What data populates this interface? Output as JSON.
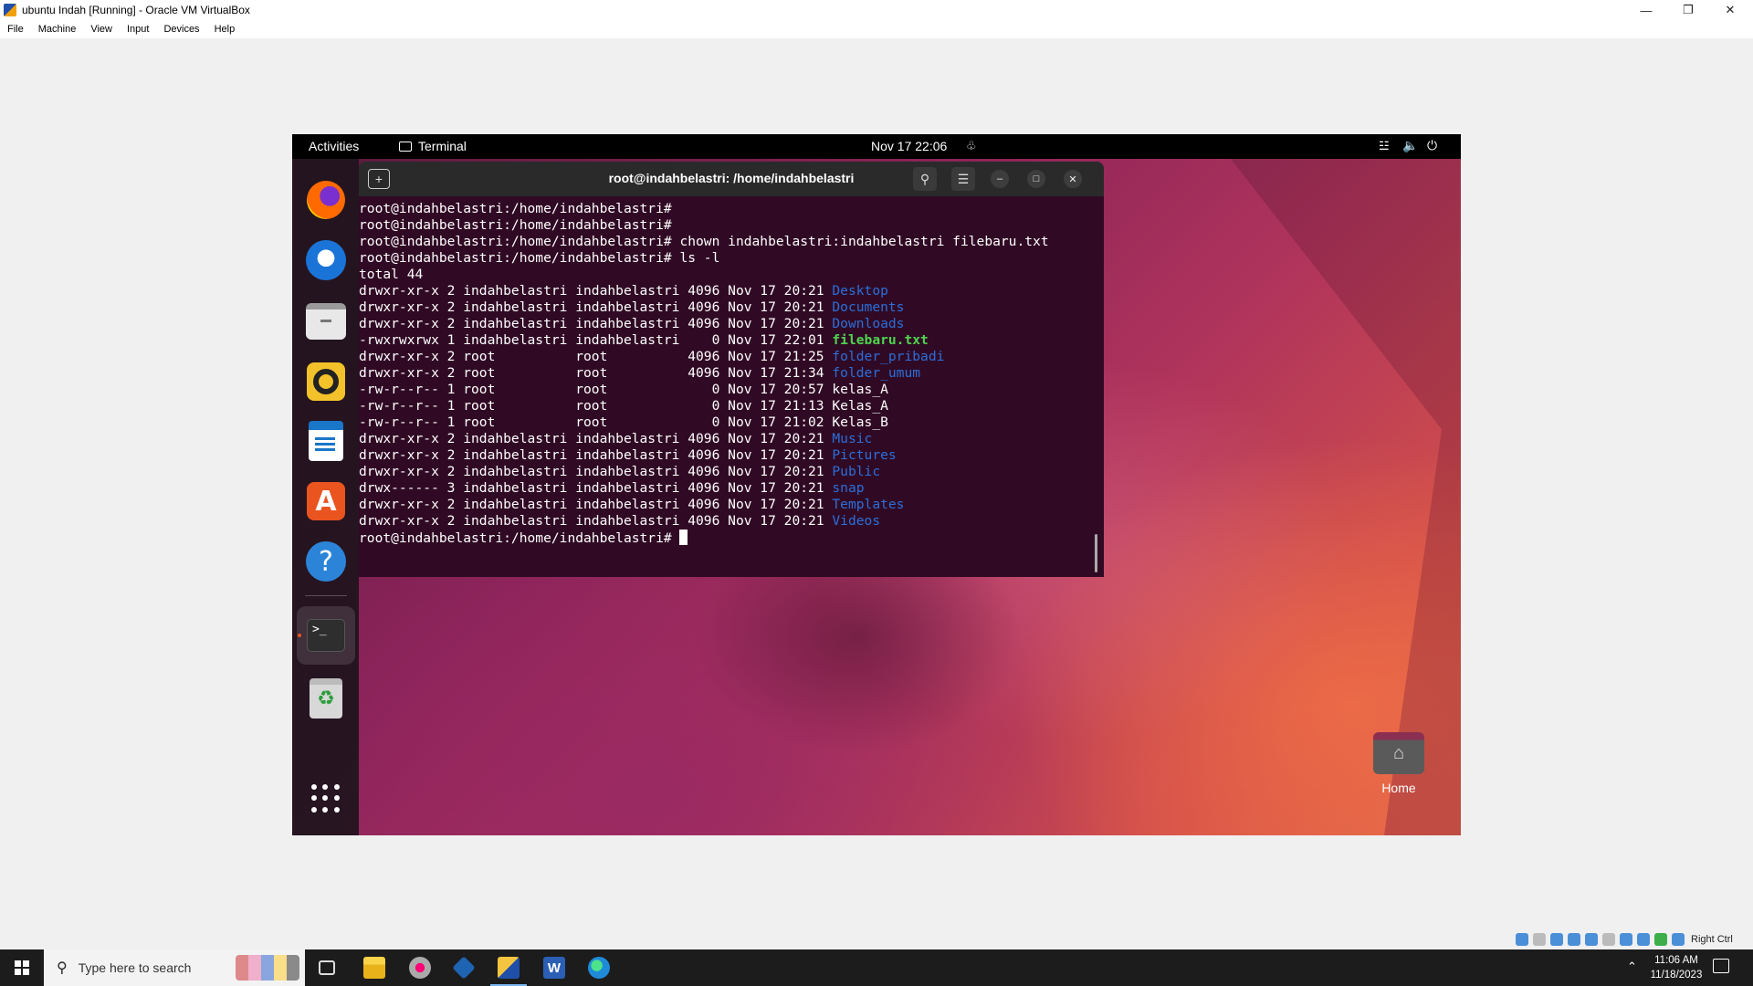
{
  "host": {
    "title": "ubuntu Indah [Running] - Oracle VM VirtualBox",
    "menu": [
      "File",
      "Machine",
      "View",
      "Input",
      "Devices",
      "Help"
    ],
    "host_key": "Right Ctrl"
  },
  "guest": {
    "topbar": {
      "activities": "Activities",
      "app_name": "Terminal",
      "clock": "Nov 17  22:06"
    },
    "dock": {
      "items": [
        "firefox",
        "thunderbird",
        "files",
        "rhythmbox",
        "libreoffice-writer",
        "ubuntu-software",
        "help",
        "terminal",
        "trash",
        "show-applications"
      ],
      "terminal_glyph": ">_",
      "trash_glyph": "♻"
    },
    "terminal": {
      "title": "root@indahbelastri: /home/indahbelastri",
      "lines": [
        {
          "text": "root@indahbelastri:/home/indahbelastri#",
          "name": ""
        },
        {
          "text": "root@indahbelastri:/home/indahbelastri#",
          "name": ""
        },
        {
          "text": "root@indahbelastri:/home/indahbelastri# chown indahbelastri:indahbelastri filebaru.txt",
          "name": ""
        },
        {
          "text": "root@indahbelastri:/home/indahbelastri# ls -l",
          "name": ""
        },
        {
          "text": "total 44",
          "name": ""
        },
        {
          "text": "drwxr-xr-x 2 indahbelastri indahbelastri 4096 Nov 17 20:21 ",
          "name": "Desktop",
          "kind": "dir"
        },
        {
          "text": "drwxr-xr-x 2 indahbelastri indahbelastri 4096 Nov 17 20:21 ",
          "name": "Documents",
          "kind": "dir"
        },
        {
          "text": "drwxr-xr-x 2 indahbelastri indahbelastri 4096 Nov 17 20:21 ",
          "name": "Downloads",
          "kind": "dir"
        },
        {
          "text": "-rwxrwxrwx 1 indahbelastri indahbelastri    0 Nov 17 22:01 ",
          "name": "filebaru.txt",
          "kind": "exe"
        },
        {
          "text": "drwxr-xr-x 2 root          root          4096 Nov 17 21:25 ",
          "name": "folder_pribadi",
          "kind": "dir"
        },
        {
          "text": "drwxr-xr-x 2 root          root          4096 Nov 17 21:34 ",
          "name": "folder_umum",
          "kind": "dir"
        },
        {
          "text": "-rw-r--r-- 1 root          root             0 Nov 17 20:57 ",
          "name": "kelas_A",
          "kind": "file"
        },
        {
          "text": "-rw-r--r-- 1 root          root             0 Nov 17 21:13 ",
          "name": "Kelas_A",
          "kind": "file"
        },
        {
          "text": "-rw-r--r-- 1 root          root             0 Nov 17 21:02 ",
          "name": "Kelas_B",
          "kind": "file"
        },
        {
          "text": "drwxr-xr-x 2 indahbelastri indahbelastri 4096 Nov 17 20:21 ",
          "name": "Music",
          "kind": "dir"
        },
        {
          "text": "drwxr-xr-x 2 indahbelastri indahbelastri 4096 Nov 17 20:21 ",
          "name": "Pictures",
          "kind": "dir"
        },
        {
          "text": "drwxr-xr-x 2 indahbelastri indahbelastri 4096 Nov 17 20:21 ",
          "name": "Public",
          "kind": "dir"
        },
        {
          "text": "drwx------ 3 indahbelastri indahbelastri 4096 Nov 17 20:21 ",
          "name": "snap",
          "kind": "dir"
        },
        {
          "text": "drwxr-xr-x 2 indahbelastri indahbelastri 4096 Nov 17 20:21 ",
          "name": "Templates",
          "kind": "dir"
        },
        {
          "text": "drwxr-xr-x 2 indahbelastri indahbelastri 4096 Nov 17 20:21 ",
          "name": "Videos",
          "kind": "dir"
        }
      ],
      "prompt": "root@indahbelastri:/home/indahbelastri# "
    },
    "desktop": {
      "home_label": "Home"
    }
  },
  "taskbar": {
    "search_placeholder": "Type here to search",
    "word_letter": "W",
    "time": "11:06 AM",
    "date": "11/18/2023"
  },
  "colors": {
    "terminal_bg": "#300a24",
    "dir": "#2a6fdb",
    "exe": "#4fd44f",
    "ubuntu_orange": "#e95420"
  }
}
